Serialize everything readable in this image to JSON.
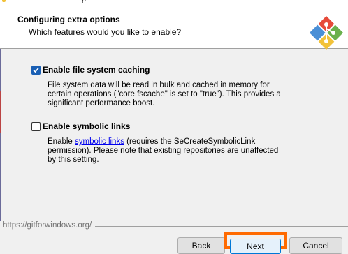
{
  "titlebar": {
    "fragment": "p"
  },
  "header": {
    "title": "Configuring extra options",
    "subtitle": "Which features would you like to enable?"
  },
  "options": [
    {
      "label": "Enable file system caching",
      "checked": true,
      "description": "File system data will be read in bulk and cached in memory for certain operations (\"core.fscache\" is set to \"true\"). This provides a significant performance boost."
    },
    {
      "label": "Enable symbolic links",
      "checked": false,
      "desc_prefix": "Enable ",
      "desc_link": "symbolic links",
      "desc_suffix": " (requires the SeCreateSymbolicLink permission). Please note that existing repositories are unaffected by this setting."
    }
  ],
  "footer": {
    "link": "https://gitforwindows.org/"
  },
  "buttons": {
    "back": "Back",
    "next": "Next",
    "cancel": "Cancel"
  },
  "colors": {
    "accent": "#1a5fb4",
    "highlight": "#ff6a00",
    "logo_red": "#e64a3a",
    "logo_green": "#6ab04c",
    "logo_blue": "#4a8fd6",
    "logo_yellow": "#f2c23a"
  }
}
